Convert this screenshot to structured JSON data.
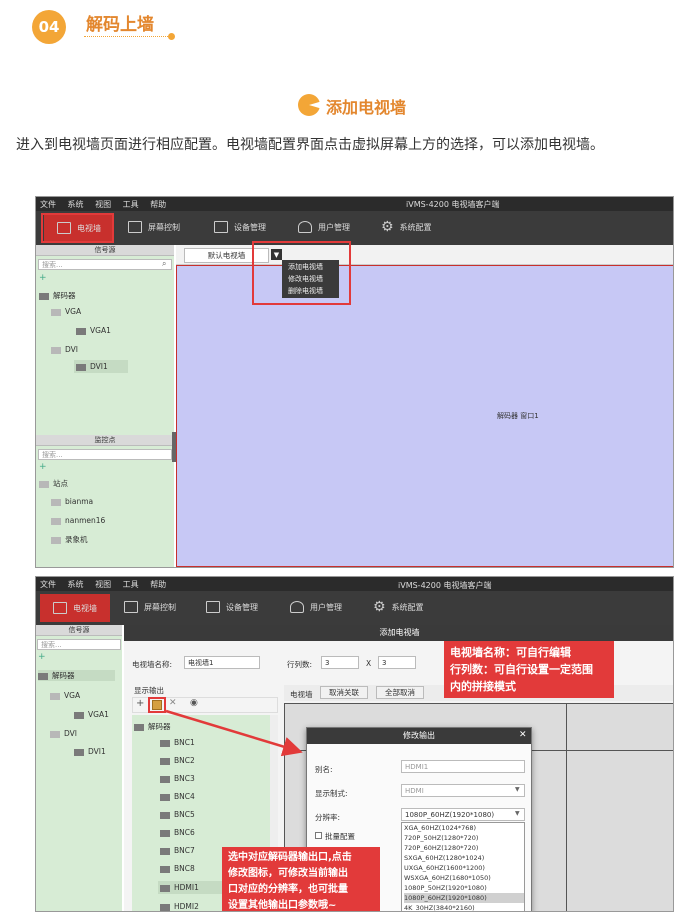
{
  "section": {
    "number": "04",
    "title": "解码上墙"
  },
  "subsection": {
    "title": "添加电视墙"
  },
  "intro": "进入到电视墙页面进行相应配置。电视墙配置界面点击虚拟屏幕上方的选择，可以添加电视墙。",
  "shot1": {
    "window_title": "iVMS-4200 电视墙客户端",
    "menu": [
      "文件",
      "系统",
      "视图",
      "工具",
      "帮助"
    ],
    "toolbar": [
      "电视墙",
      "屏幕控制",
      "设备管理",
      "用户管理",
      "系统配置"
    ],
    "signal_source": {
      "title": "信号源",
      "search_placeholder": "搜索...",
      "tree": [
        "解码器",
        "VGA",
        "VGA1",
        "DVI",
        "DVI1"
      ]
    },
    "monitor_point": {
      "title": "监控点",
      "search_placeholder": "搜索...",
      "tree": [
        "站点",
        "bianma",
        "nanmen16",
        "录象机"
      ]
    },
    "tab": "默认电视墙",
    "dropdown": [
      "添加电视墙",
      "修改电视墙",
      "删除电视墙"
    ],
    "screen_label": "解码器 窗口1",
    "colors": {
      "screen": "#c7c8f5",
      "accent": "#e23a3a",
      "toolbar": "#3b3b3b"
    }
  },
  "shot2": {
    "window_title": "iVMS-4200 电视墙客户端",
    "menu": [
      "文件",
      "系统",
      "视图",
      "工具",
      "帮助"
    ],
    "toolbar": [
      "电视墙",
      "屏幕控制",
      "设备管理",
      "用户管理",
      "系统配置"
    ],
    "signal_source": {
      "title": "信号源",
      "search_placeholder": "搜索...",
      "tree": [
        "解码器",
        "VGA",
        "VGA1",
        "DVI",
        "DVI1"
      ]
    },
    "dialog_title": "添加电视墙",
    "wall_name_label": "电视墙名称:",
    "wall_name_value": "电视墙1",
    "rows_cols_label": "行列数:",
    "rows": "3",
    "x": "X",
    "cols": "3",
    "display_output": "显示输出",
    "outputs": [
      "解码器",
      "BNC1",
      "BNC2",
      "BNC3",
      "BNC4",
      "BNC5",
      "BNC6",
      "BNC7",
      "BNC8",
      "HDMI1",
      "HDMI2"
    ],
    "wall_tab": "电视墙",
    "unlink_btn": "取消关联",
    "cancel_all_btn": "全部取消",
    "modify_dialog": {
      "title": "修改输出",
      "alias_label": "别名:",
      "alias_value": "HDMI1",
      "format_label": "显示制式:",
      "format_value": "HDMI",
      "resolution_label": "分辨率:",
      "resolution_value": "1080P_60HZ(1920*1080)",
      "batch_label": "批量配置",
      "options": [
        "XGA_60HZ(1024*768)",
        "720P_50HZ(1280*720)",
        "720P_60HZ(1280*720)",
        "SXGA_60HZ(1280*1024)",
        "UXGA_60HZ(1600*1200)",
        "WSXGA_60HZ(1680*1050)",
        "1080P_50HZ(1920*1080)",
        "1080P_60HZ(1920*1080)",
        "4K_30HZ(3840*2160)"
      ]
    },
    "note_top": [
      "电视墙名称：可自行编辑",
      "行列数：可自行设置一定范围",
      "内的拼接模式"
    ],
    "note_bottom": [
      "选中对应解码器输出口,点击",
      "修改图标，可修改当前输出",
      "口对应的分辨率，也可批量",
      "设置其他输出口参数哦~"
    ]
  }
}
